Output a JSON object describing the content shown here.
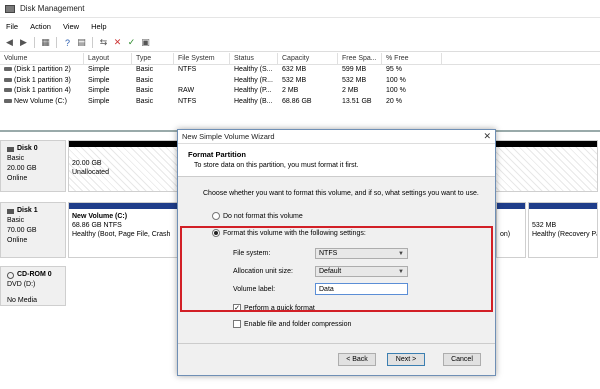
{
  "window": {
    "title": "Disk Management"
  },
  "menu": [
    "File",
    "Action",
    "View",
    "Help"
  ],
  "toolbar_icons": [
    "back-arrow-icon",
    "forward-arrow-icon",
    "grid-icon",
    "help-icon",
    "properties-icon",
    "connect-icon",
    "delete-icon",
    "check-icon",
    "refresh-icon"
  ],
  "volumes": {
    "headers": [
      "Volume",
      "Layout",
      "Type",
      "File System",
      "Status",
      "Capacity",
      "Free Spa...",
      "% Free"
    ],
    "rows": [
      [
        "(Disk 1 partition 2)",
        "Simple",
        "Basic",
        "NTFS",
        "Healthy (S...",
        "632 MB",
        "599 MB",
        "95 %"
      ],
      [
        "(Disk 1 partition 3)",
        "Simple",
        "Basic",
        "",
        "Healthy (R...",
        "532 MB",
        "532 MB",
        "100 %"
      ],
      [
        "(Disk 1 partition 4)",
        "Simple",
        "Basic",
        "RAW",
        "Healthy (P...",
        "2 MB",
        "2 MB",
        "100 %"
      ],
      [
        "New Volume (C:)",
        "Simple",
        "Basic",
        "NTFS",
        "Healthy (B...",
        "68.86 GB",
        "13.51 GB",
        "20 %"
      ]
    ]
  },
  "disks": [
    {
      "name": "Disk 0",
      "type": "Basic",
      "size": "20.00 GB",
      "status": "Online",
      "partition": {
        "size": "20.00 GB",
        "status": "Unallocated"
      }
    },
    {
      "name": "Disk 1",
      "type": "Basic",
      "size": "70.00 GB",
      "status": "Online",
      "partition": {
        "name": "New Volume (C:)",
        "size": "68.86 GB NTFS",
        "status": "Healthy (Boot, Page File, Crash"
      },
      "partition_mid_fragment": "on)",
      "partition_right": {
        "size": "532 MB",
        "status": "Healthy (Recovery Pa"
      }
    },
    {
      "name": "CD-ROM 0",
      "type": "DVD (D:)",
      "status": "No Media"
    }
  ],
  "dialog": {
    "title": "New Simple Volume Wizard",
    "close_glyph": "✕",
    "header_title": "Format Partition",
    "header_sub": "To store data on this partition, you must format it first.",
    "instruction": "Choose whether you want to format this volume, and if so, what settings you want to use.",
    "radio_no_format": "Do not format this volume",
    "radio_format": "Format this volume with the following settings:",
    "file_system_label": "File system:",
    "file_system_value": "NTFS",
    "alloc_label": "Allocation unit size:",
    "alloc_value": "Default",
    "volume_label_label": "Volume label:",
    "volume_label_value": "Data",
    "quick_format": "Perform a quick format",
    "compression": "Enable file and folder compression",
    "back_button": "< Back",
    "next_button": "Next >",
    "cancel_button": "Cancel",
    "selected_radio": "format",
    "quick_format_checked": true,
    "compression_checked": false
  },
  "colors": {
    "partition_bar": "#1f3d8a",
    "disk0_bar": "#000000",
    "highlight": "#d21f26"
  }
}
